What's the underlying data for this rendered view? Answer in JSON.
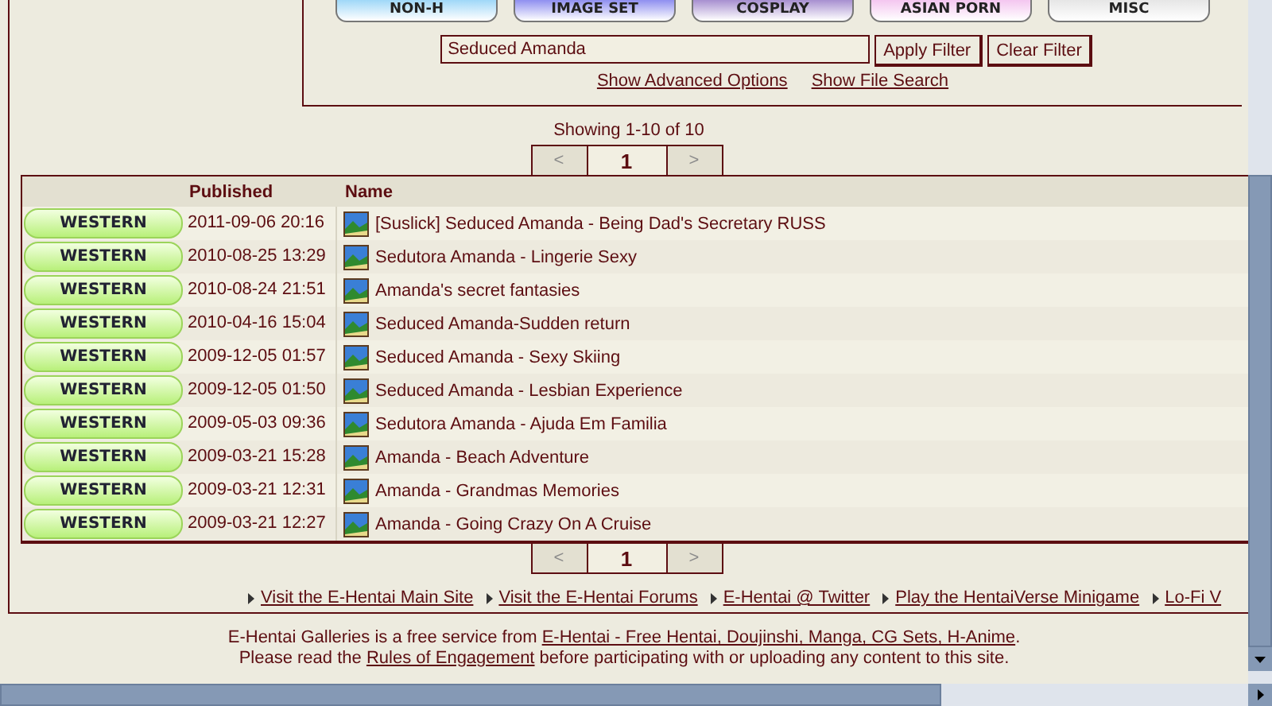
{
  "categories": [
    {
      "label": "NON-H",
      "color": "#9fd8f8"
    },
    {
      "label": "IMAGE SET",
      "color": "#8f8ff0"
    },
    {
      "label": "COSPLAY",
      "color": "#a78fd0"
    },
    {
      "label": "ASIAN PORN",
      "color": "#f4c6f0"
    },
    {
      "label": "MISC",
      "color": "#e6e6e6"
    }
  ],
  "search": {
    "value": "Seduced Amanda",
    "buttons": [
      "Apply Filter",
      "Clear Filter"
    ],
    "links": [
      "Show Advanced Options",
      "Show File Search"
    ]
  },
  "showing": "Showing 1-10 of 10",
  "pager_top": [
    {
      "label": "<",
      "selected": false,
      "disabled": true
    },
    {
      "label": "1",
      "selected": true,
      "disabled": false
    },
    {
      "label": ">",
      "selected": false,
      "disabled": true
    }
  ],
  "pager_bottom": [
    {
      "label": "<",
      "selected": false,
      "disabled": true
    },
    {
      "label": "1",
      "selected": true,
      "disabled": false
    },
    {
      "label": ">",
      "selected": false,
      "disabled": true
    }
  ],
  "table": {
    "columns": [
      "Published",
      "Name"
    ],
    "rows": [
      {
        "category": "WESTERN",
        "published": "2011-09-06 20:16",
        "name": "[Suslick] Seduced Amanda - Being Dad's Secretary RUSS"
      },
      {
        "category": "WESTERN",
        "published": "2010-08-25 13:29",
        "name": "Sedutora Amanda - Lingerie Sexy"
      },
      {
        "category": "WESTERN",
        "published": "2010-08-24 21:51",
        "name": "Amanda's secret fantasies"
      },
      {
        "category": "WESTERN",
        "published": "2010-04-16 15:04",
        "name": "Seduced Amanda-Sudden return"
      },
      {
        "category": "WESTERN",
        "published": "2009-12-05 01:57",
        "name": "Seduced Amanda - Sexy Skiing"
      },
      {
        "category": "WESTERN",
        "published": "2009-12-05 01:50",
        "name": "Seduced Amanda - Lesbian Experience"
      },
      {
        "category": "WESTERN",
        "published": "2009-05-03 09:36",
        "name": "Sedutora Amanda - Ajuda Em Familia"
      },
      {
        "category": "WESTERN",
        "published": "2009-03-21 15:28",
        "name": "Amanda - Beach Adventure"
      },
      {
        "category": "WESTERN",
        "published": "2009-03-21 12:31",
        "name": "Amanda - Grandmas Memories"
      },
      {
        "category": "WESTERN",
        "published": "2009-03-21 12:27",
        "name": "Amanda - Going Crazy On A Cruise"
      }
    ]
  },
  "footer_links": [
    "Visit the E-Hentai Main Site",
    "Visit the E-Hentai Forums",
    "E-Hentai @ Twitter",
    "Play the HentaiVerse Minigame",
    "Lo-Fi V"
  ],
  "footer_lines": [
    {
      "before": "E-Hentai Galleries is a free service from ",
      "link": "E-Hentai - Free Hentai, Doujinshi, Manga, CG Sets, H-Anime",
      "after": "."
    },
    {
      "before": "Please read the ",
      "link": "Rules of Engagement",
      "after": " before participating with or uploading any content to this site."
    }
  ]
}
